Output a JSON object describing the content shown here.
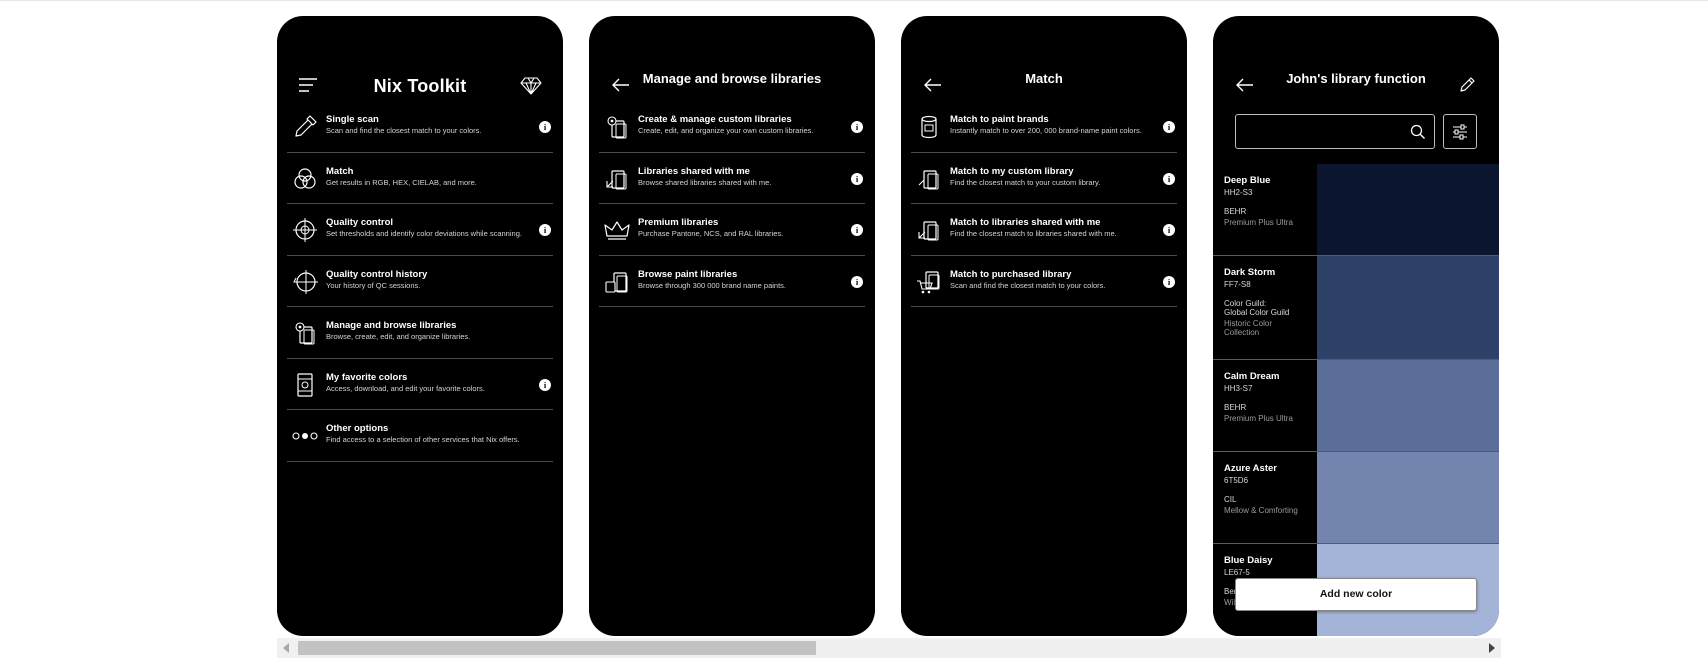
{
  "screen1": {
    "title": "Nix Toolkit",
    "items": [
      {
        "icon": "eyedropper-icon",
        "title": "Single scan",
        "desc": "Scan and find the closest match to your colors.",
        "info": true
      },
      {
        "icon": "color-circles-icon",
        "title": "Match",
        "desc": "Get results in RGB, HEX, CIELAB, and more.",
        "info": false
      },
      {
        "icon": "crosshair-icon",
        "title": "Quality control",
        "desc": "Set thresholds and identify color deviations while scanning.",
        "info": true
      },
      {
        "icon": "crosshair-history-icon",
        "title": "Quality control history",
        "desc": "Your history of QC sessions.",
        "info": false
      },
      {
        "icon": "library-gear-icon",
        "title": "Manage and browse libraries",
        "desc": "Browse, create, edit, and organize libraries.",
        "info": false
      },
      {
        "icon": "favorite-colors-icon",
        "title": "My favorite colors",
        "desc": "Access, download, and edit your favorite colors.",
        "info": true
      },
      {
        "icon": "dots-icon",
        "title": "Other options",
        "desc": "Find access to a selection of other services that Nix offers.",
        "info": false
      }
    ]
  },
  "screen2": {
    "title": "Manage and browse libraries",
    "items": [
      {
        "icon": "library-gear-icon",
        "title": "Create & manage custom libraries",
        "desc": "Create, edit, and organize your own custom libraries.",
        "info": true
      },
      {
        "icon": "library-share-icon",
        "title": "Libraries shared with me",
        "desc": "Browse shared libraries shared with me.",
        "info": true
      },
      {
        "icon": "crown-icon",
        "title": "Premium libraries",
        "desc": "Purchase Pantone, NCS, and RAL libraries.",
        "info": true
      },
      {
        "icon": "paint-library-icon",
        "title": "Browse paint libraries",
        "desc": "Browse through 300 000 brand name paints.",
        "info": true
      }
    ]
  },
  "screen3": {
    "title": "Match",
    "items": [
      {
        "icon": "paint-can-icon",
        "title": "Match to paint brands",
        "desc": "Instantly match to over 200, 000 brand-name paint colors.",
        "info": true
      },
      {
        "icon": "custom-library-icon",
        "title": "Match to my custom library",
        "desc": "Find the closest match to your custom library.",
        "info": true
      },
      {
        "icon": "shared-library-icon",
        "title": "Match to libraries shared with me",
        "desc": "Find the closest match to libraries shared with me.",
        "info": true
      },
      {
        "icon": "cart-library-icon",
        "title": "Match to purchased library",
        "desc": "Scan and find the closest match to your colors.",
        "info": true
      }
    ]
  },
  "screen4": {
    "title": "John's library function",
    "search": {
      "value": "",
      "placeholder": ""
    },
    "add_button": "Add new color",
    "colors": [
      {
        "name": "Deep Blue",
        "code": "HH2-S3",
        "brand": "BEHR",
        "line": "Premium Plus Ultra",
        "hex": "#0b1530"
      },
      {
        "name": "Dark Storm",
        "code": "FF7-S8",
        "brand": "Color Guild:\nGlobal Color Guild",
        "line": "Historic Color\nCollection",
        "hex": "#2d4169"
      },
      {
        "name": "Calm Dream",
        "code": "HH3-S7",
        "brand": "BEHR",
        "line": "Premium Plus Ultra",
        "hex": "#5b6e99"
      },
      {
        "name": "Azure Aster",
        "code": "6T5D6",
        "brand": "CIL",
        "line": "Mellow & Comforting",
        "hex": "#7385ae"
      },
      {
        "name": "Blue Daisy",
        "code": "LE67-5",
        "brand": "Benjamin Moore",
        "line": "Williamsburg",
        "hex": "#a4b4d8"
      }
    ]
  }
}
